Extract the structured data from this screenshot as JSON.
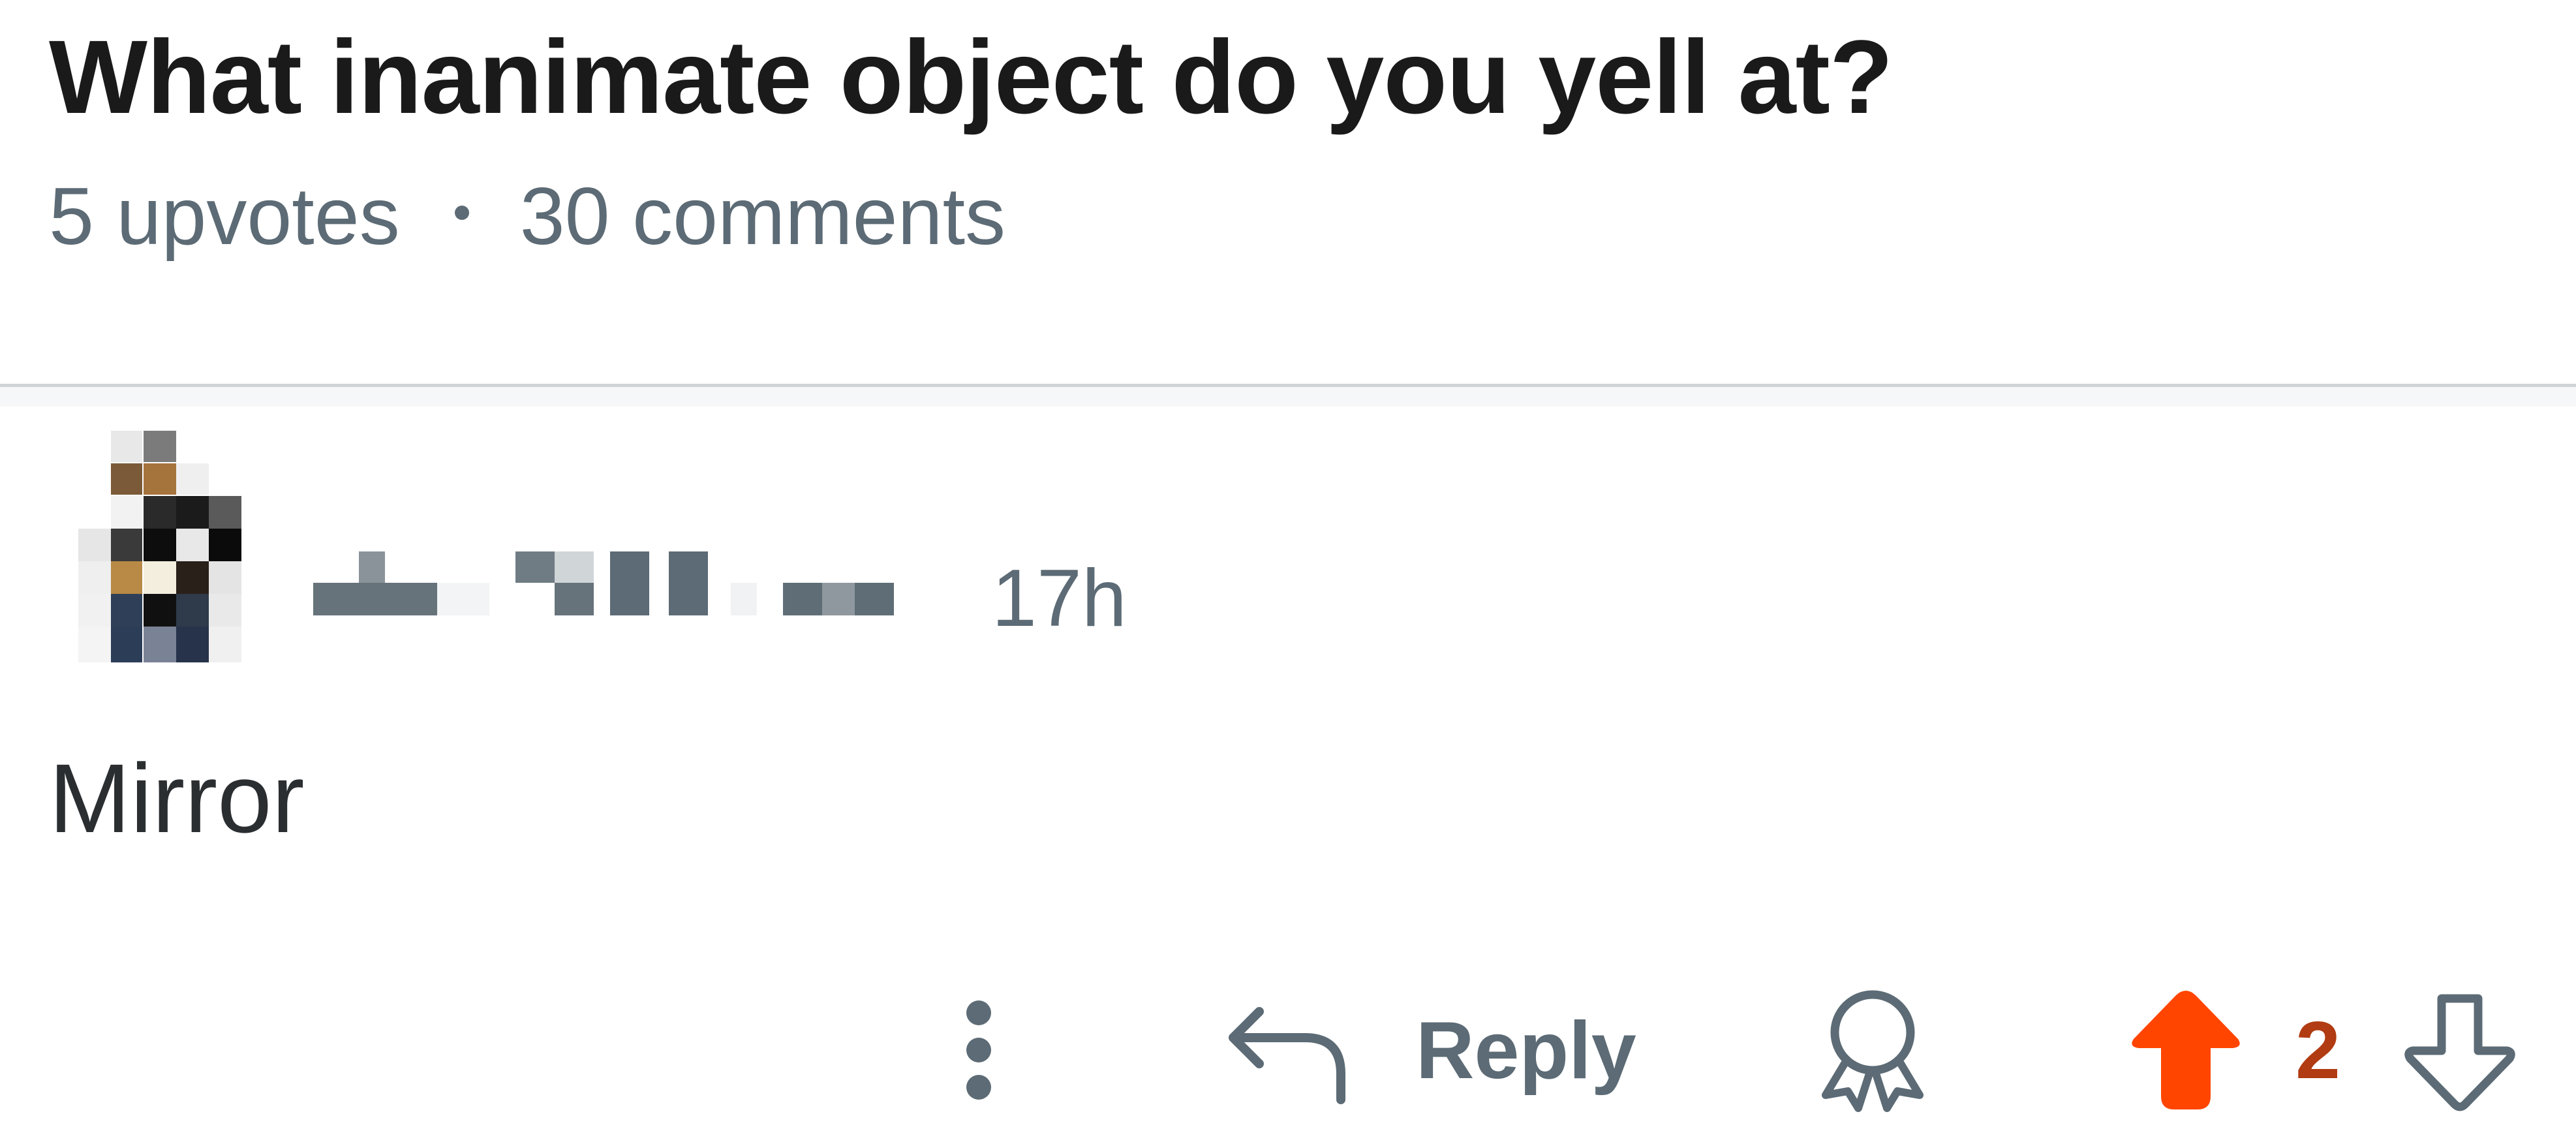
{
  "post": {
    "title": "What inanimate object do you yell at?",
    "upvotes": "5 upvotes",
    "comments": "30 comments"
  },
  "comment": {
    "author_avatar_icon": "pixelated-avatar-icon",
    "author_name_redacted": true,
    "timestamp": "17h",
    "body": "Mirror",
    "actions": {
      "more_icon": "vertical-ellipsis-icon",
      "reply_icon": "reply-arrow-icon",
      "reply_label": "Reply",
      "award_icon": "award-ribbon-icon",
      "upvote_icon": "upvote-arrow-icon",
      "vote_count": "2",
      "downvote_icon": "downvote-arrow-icon"
    }
  },
  "colors": {
    "title": "#1a1a1b",
    "meta": "#5c6b75",
    "upvote_active": "#ff4500",
    "vote_count": "#b13b12",
    "divider": "#cfd3d6"
  }
}
